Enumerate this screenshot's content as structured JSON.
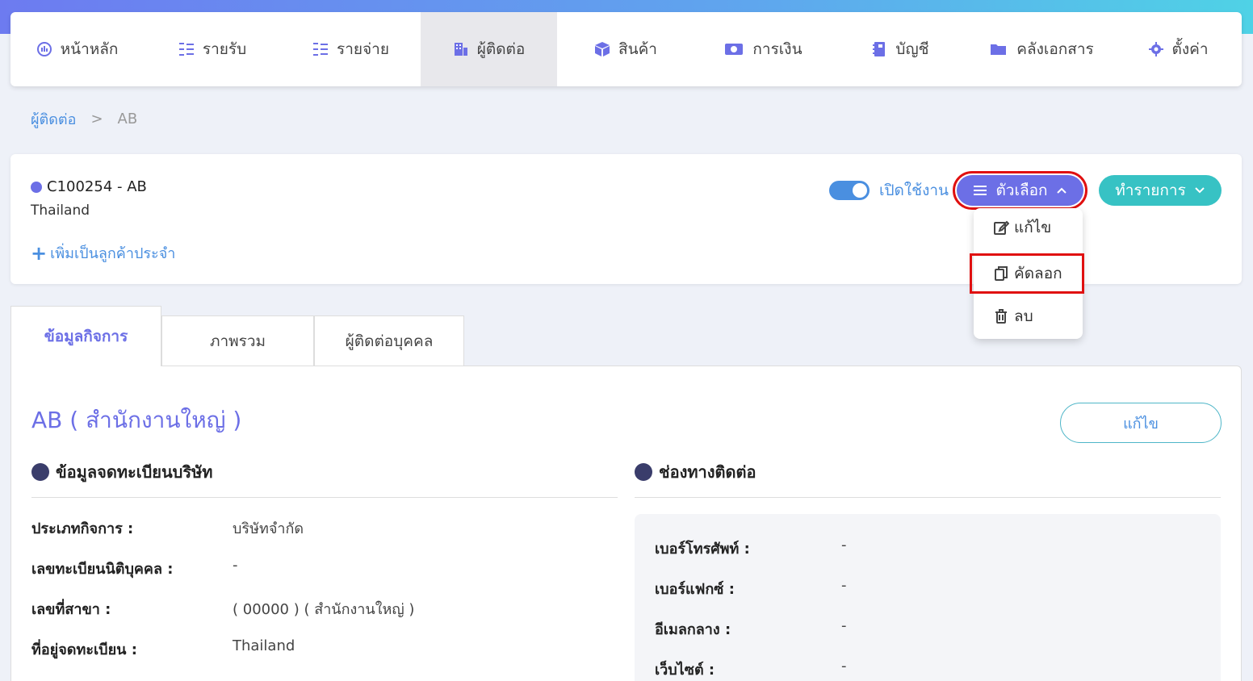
{
  "nav": {
    "items": [
      {
        "label": "หน้าหลัก",
        "icon": "dashboard-icon"
      },
      {
        "label": "รายรับ",
        "icon": "income-icon"
      },
      {
        "label": "รายจ่าย",
        "icon": "expense-icon"
      },
      {
        "label": "ผู้ติดต่อ",
        "icon": "contacts-icon"
      },
      {
        "label": "สินค้า",
        "icon": "box-icon"
      },
      {
        "label": "การเงิน",
        "icon": "money-icon"
      },
      {
        "label": "บัญชี",
        "icon": "ledger-icon"
      },
      {
        "label": "คลังเอกสาร",
        "icon": "folder-icon"
      },
      {
        "label": "ตั้งค่า",
        "icon": "gear-icon"
      }
    ],
    "active_index": 3
  },
  "breadcrumb": {
    "root": "ผู้ติดต่อ",
    "separator": ">",
    "current": "AB"
  },
  "contact": {
    "code_name": "C100254 - AB",
    "country": "Thailand",
    "add_regular": "เพิ่มเป็นลูกค้าประจำ",
    "toggle_label": "เปิดใช้งาน",
    "options_label": "ตัวเลือก",
    "transact_label": "ทำรายการ"
  },
  "dropdown": {
    "edit": "แก้ไข",
    "copy": "คัดลอก",
    "delete": "ลบ"
  },
  "tabs": [
    "ข้อมูลกิจการ",
    "ภาพรวม",
    "ผู้ติดต่อบุคคล"
  ],
  "info": {
    "title": "AB ( สำนักงานใหญ่ )",
    "edit_label": "แก้ไข",
    "registration_heading": "ข้อมูลจดทะเบียนบริษัท",
    "contact_heading": "ช่องทางติดต่อ",
    "registration_rows": [
      {
        "label": "ประเภทกิจการ :",
        "value": "บริษัทจำกัด"
      },
      {
        "label": "เลขทะเบียนนิติบุคคล :",
        "value": "-"
      },
      {
        "label": "เลขที่สาขา :",
        "value": "( 00000 ) ( สำนักงานใหญ่ )"
      },
      {
        "label": "ที่อยู่จดทะเบียน :",
        "value": "Thailand"
      }
    ],
    "contact_rows": [
      {
        "label": "เบอร์โทรศัพท์ :",
        "value": "-"
      },
      {
        "label": "เบอร์แฟกซ์ :",
        "value": "-"
      },
      {
        "label": "อีเมลกลาง :",
        "value": "-"
      },
      {
        "label": "เว็บไซต์ :",
        "value": "-"
      }
    ]
  },
  "colors": {
    "accent": "#6c6fe6",
    "teal": "#37c2c4",
    "link": "#4a8fe0",
    "highlight": "#e01010"
  }
}
